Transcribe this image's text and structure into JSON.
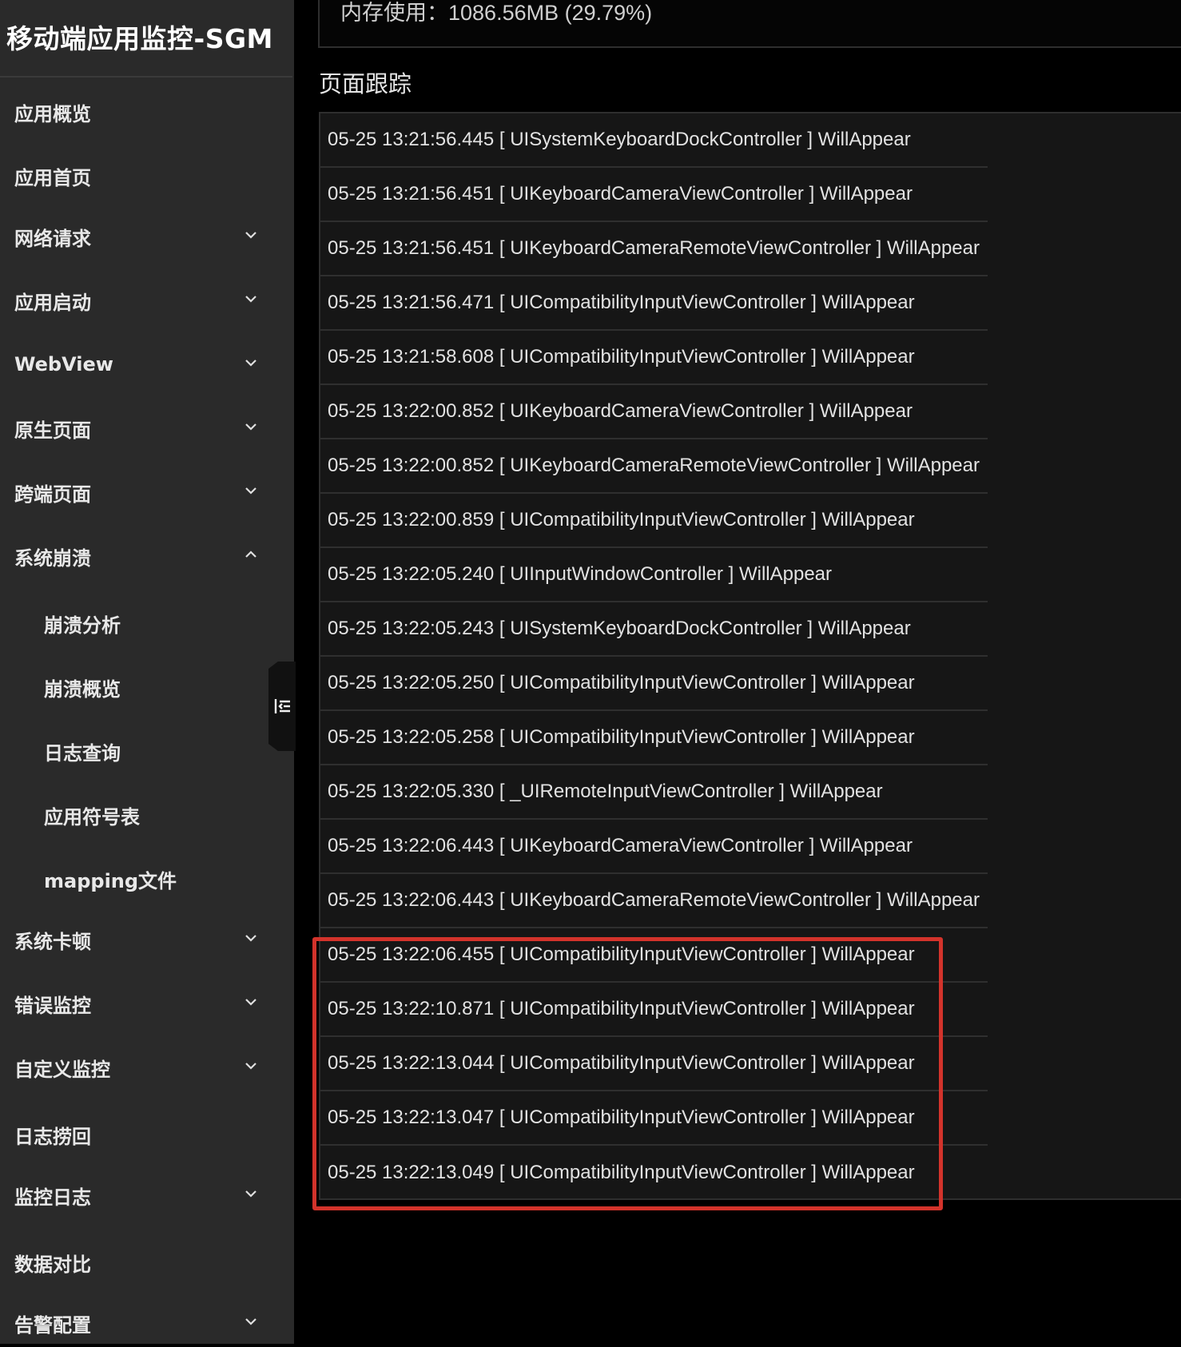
{
  "sidebar": {
    "title": "移动端应用监控-SGM",
    "items": [
      {
        "label": "应用概览",
        "chevron": "none"
      },
      {
        "label": "应用首页",
        "chevron": "none"
      },
      {
        "label": "网络请求",
        "chevron": "down"
      },
      {
        "label": "应用启动",
        "chevron": "down"
      },
      {
        "label": "WebView",
        "chevron": "down"
      },
      {
        "label": "原生页面",
        "chevron": "down"
      },
      {
        "label": "跨端页面",
        "chevron": "down"
      },
      {
        "label": "系统崩溃",
        "chevron": "up",
        "expanded": true
      },
      {
        "label": "崩溃分析",
        "sub": true
      },
      {
        "label": "崩溃概览",
        "sub": true
      },
      {
        "label": "日志查询",
        "sub": true
      },
      {
        "label": "应用符号表",
        "sub": true
      },
      {
        "label": "mapping文件",
        "sub": true
      },
      {
        "label": "系统卡顿",
        "chevron": "down"
      },
      {
        "label": "错误监控",
        "chevron": "down"
      },
      {
        "label": "自定义监控",
        "chevron": "down"
      },
      {
        "label": "日志捞回",
        "chevron": "none"
      },
      {
        "label": "监控日志",
        "chevron": "down"
      },
      {
        "label": "数据对比",
        "chevron": "none"
      },
      {
        "label": "告警配置",
        "chevron": "down"
      }
    ]
  },
  "memory": {
    "text": "内存使用：1086.56MB (29.79%)"
  },
  "page_trace": {
    "title": "页面跟踪",
    "rows": [
      "05-25 13:21:56.445 [ UISystemKeyboardDockController ] WillAppear",
      "05-25 13:21:56.451 [ UIKeyboardCameraViewController ] WillAppear",
      "05-25 13:21:56.451 [ UIKeyboardCameraRemoteViewController ] WillAppear",
      "05-25 13:21:56.471 [ UICompatibilityInputViewController ] WillAppear",
      "05-25 13:21:58.608 [ UICompatibilityInputViewController ] WillAppear",
      "05-25 13:22:00.852 [ UIKeyboardCameraViewController ] WillAppear",
      "05-25 13:22:00.852 [ UIKeyboardCameraRemoteViewController ] WillAppear",
      "05-25 13:22:00.859 [ UICompatibilityInputViewController ] WillAppear",
      "05-25 13:22:05.240 [ UIInputWindowController ] WillAppear",
      "05-25 13:22:05.243 [ UISystemKeyboardDockController ] WillAppear",
      "05-25 13:22:05.250 [ UICompatibilityInputViewController ] WillAppear",
      "05-25 13:22:05.258 [ UICompatibilityInputViewController ] WillAppear",
      "05-25 13:22:05.330 [ _UIRemoteInputViewController ] WillAppear",
      "05-25 13:22:06.443 [ UIKeyboardCameraViewController ] WillAppear",
      "05-25 13:22:06.443 [ UIKeyboardCameraRemoteViewController ] WillAppear",
      "05-25 13:22:06.455 [ UICompatibilityInputViewController ] WillAppear",
      "05-25 13:22:10.871 [ UICompatibilityInputViewController ] WillAppear",
      "05-25 13:22:13.044 [ UICompatibilityInputViewController ] WillAppear",
      "05-25 13:22:13.047 [ UICompatibilityInputViewController ] WillAppear",
      "05-25 13:22:13.049 [ UICompatibilityInputViewController ] WillAppear"
    ]
  },
  "colors": {
    "sidebar_bg": "#2a2a2a",
    "main_bg": "#000000",
    "panel_bg": "#161616",
    "highlight": "#d3332b"
  }
}
